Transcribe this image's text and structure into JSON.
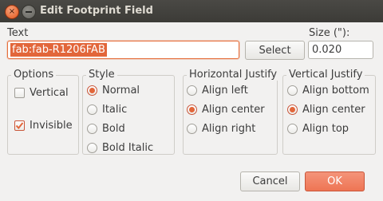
{
  "window": {
    "title": "Edit Footprint Field",
    "close_glyph": "×"
  },
  "text": {
    "label": "Text",
    "value": "fab:fab-R1206FAB",
    "select_button": "Select"
  },
  "size": {
    "label": "Size (\"):",
    "value": "0.020"
  },
  "options": {
    "label": "Options",
    "vertical": {
      "label": "Vertical",
      "checked": false
    },
    "invisible": {
      "label": "Invisible",
      "checked": true
    }
  },
  "style": {
    "label": "Style",
    "items": [
      {
        "label": "Normal",
        "selected": true
      },
      {
        "label": "Italic",
        "selected": false
      },
      {
        "label": "Bold",
        "selected": false
      },
      {
        "label": "Bold Italic",
        "selected": false
      }
    ]
  },
  "horizontal_justify": {
    "label": "Horizontal Justify",
    "items": [
      {
        "label": "Align left",
        "selected": false
      },
      {
        "label": "Align center",
        "selected": true
      },
      {
        "label": "Align right",
        "selected": false
      }
    ]
  },
  "vertical_justify": {
    "label": "Vertical Justify",
    "items": [
      {
        "label": "Align bottom",
        "selected": false
      },
      {
        "label": "Align center",
        "selected": true
      },
      {
        "label": "Align top",
        "selected": false
      }
    ]
  },
  "footer": {
    "cancel": "Cancel",
    "ok": "OK"
  },
  "colors": {
    "accent": "#e2663a",
    "titlebar": "#3c3b37",
    "background": "#f2f1f0"
  }
}
